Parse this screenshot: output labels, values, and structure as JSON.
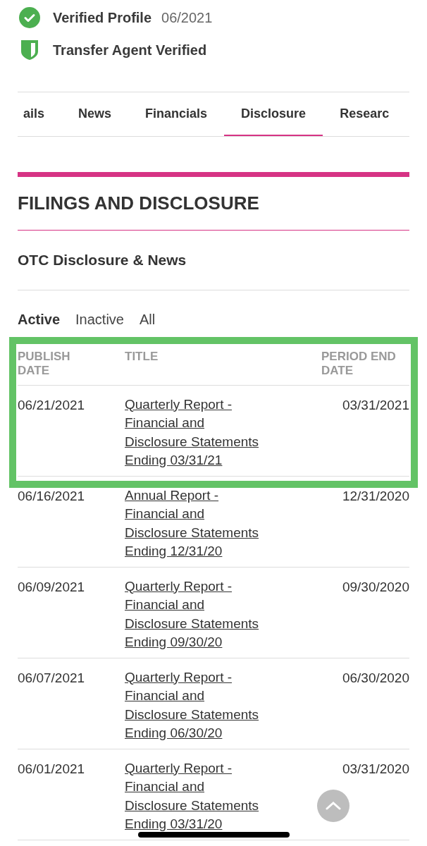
{
  "badges": [
    {
      "kind": "check",
      "label": "Verified Profile",
      "date": "06/2021"
    },
    {
      "kind": "shield",
      "label": "Transfer Agent Verified"
    }
  ],
  "tabs": [
    {
      "label": "ails",
      "selected": false
    },
    {
      "label": "News",
      "selected": false
    },
    {
      "label": "Financials",
      "selected": false
    },
    {
      "label": "Disclosure",
      "selected": true
    },
    {
      "label": "Researc",
      "selected": false
    }
  ],
  "section_title": "FILINGS AND DISCLOSURE",
  "subsection_title": "OTC Disclosure & News",
  "filters": [
    {
      "label": "Active",
      "selected": true
    },
    {
      "label": "Inactive",
      "selected": false
    },
    {
      "label": "All",
      "selected": false
    }
  ],
  "table": {
    "highlighted": true,
    "columns": [
      "PUBLISH DATE",
      "TITLE",
      "PERIOD END DATE"
    ],
    "rows": [
      {
        "publish_date": "06/21/2021",
        "title": "Quarterly Report - Financial and Disclosure Statements Ending 03/31/21",
        "period_end": "03/31/2021"
      },
      {
        "publish_date": "06/16/2021",
        "title": "Annual Report - Financial and Disclosure Statements Ending 12/31/20",
        "period_end": "12/31/2020"
      },
      {
        "publish_date": "06/09/2021",
        "title": "Quarterly Report - Financial and Disclosure Statements Ending 09/30/20",
        "period_end": "09/30/2020"
      },
      {
        "publish_date": "06/07/2021",
        "title": "Quarterly Report - Financial and Disclosure Statements Ending 06/30/20",
        "period_end": "06/30/2020"
      },
      {
        "publish_date": "06/01/2021",
        "title": "Quarterly Report - Financial and Disclosure Statements Ending 03/31/20",
        "period_end": "03/31/2020"
      }
    ]
  }
}
